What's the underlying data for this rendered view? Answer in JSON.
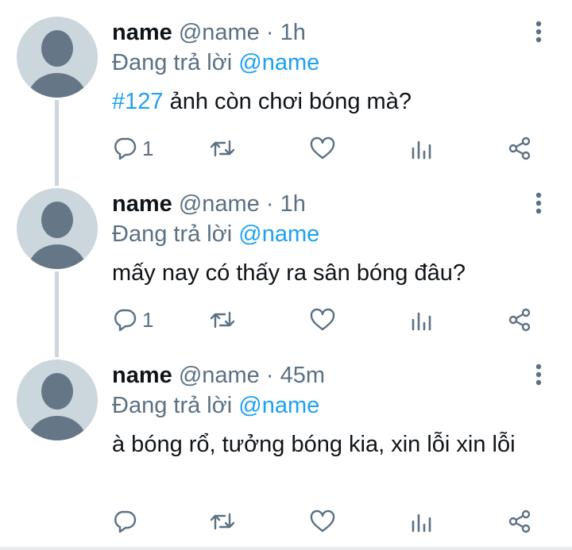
{
  "colors": {
    "accent": "#1da1f2",
    "muted": "#5b7083",
    "text": "#0f1419",
    "avatar_bg": "#ccd6dd"
  },
  "tweets": [
    {
      "name": "name",
      "handle": "@name",
      "time": "1h",
      "reply_prefix": "Đang trả lời",
      "reply_to": "@name",
      "hashtag": "#127",
      "text": " ảnh còn chơi bóng mà?",
      "reply_count": "1"
    },
    {
      "name": "name",
      "handle": "@name",
      "time": "1h",
      "reply_prefix": "Đang trả lời",
      "reply_to": "@name",
      "text": "mấy nay có thấy ra sân bóng đâu?",
      "reply_count": "1"
    },
    {
      "name": "name",
      "handle": "@name",
      "time": "45m",
      "reply_prefix": "Đang trả lời",
      "reply_to": "@name",
      "text": "à bóng rổ, tưởng bóng kia, xin lỗi xin lỗi",
      "reply_count": ""
    }
  ],
  "icons": [
    "avatar-placeholder",
    "more-vertical-icon",
    "reply-icon",
    "retweet-icon",
    "like-icon",
    "analytics-icon",
    "share-icon"
  ]
}
